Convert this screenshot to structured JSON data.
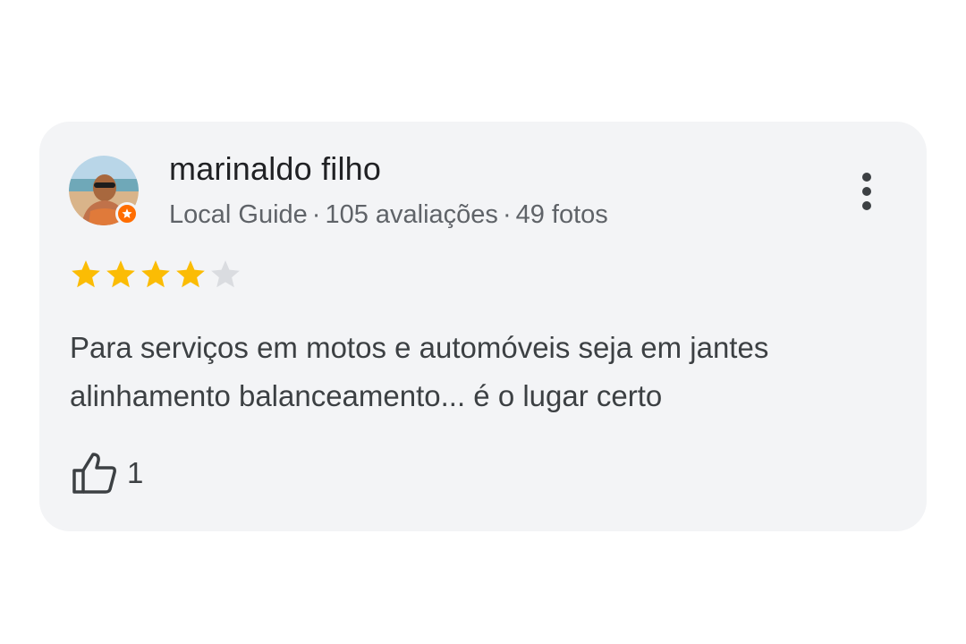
{
  "review": {
    "author": {
      "name": "marinaldo filho",
      "badge": "Local Guide",
      "reviews_count": "105 avaliações",
      "photos_count": "49 fotos",
      "separator": "·",
      "avatar_icon": "user-avatar-photo",
      "badge_icon": "local-guide-star-badge"
    },
    "rating": {
      "value": 4,
      "max": 5,
      "filled_color": "#fbbc04",
      "empty_color": "#dadce0"
    },
    "text": "Para serviços em motos e automóveis seja em jantes alinhamento balanceamento... é o lugar certo",
    "likes": {
      "count": "1",
      "icon": "thumbs-up-icon"
    },
    "more_icon": "more-vert-icon"
  },
  "colors": {
    "card_background": "#f3f4f6",
    "badge": "#ff6d00",
    "name": "#202124",
    "meta": "#5f6368"
  }
}
